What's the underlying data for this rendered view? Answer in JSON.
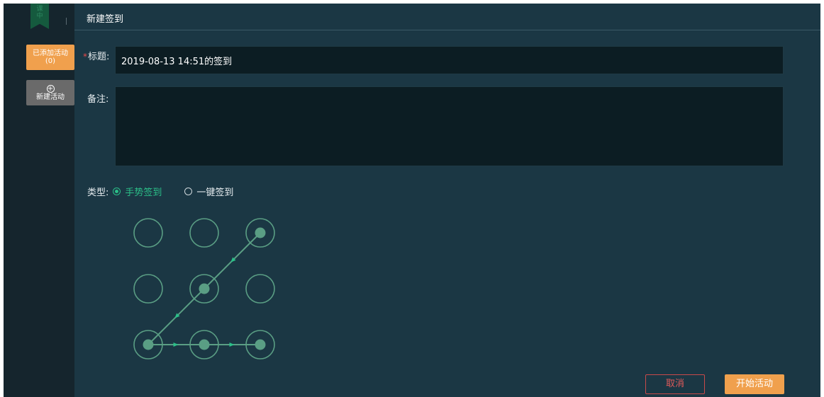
{
  "logo": {
    "chars": [
      "课",
      "中"
    ]
  },
  "sidebar": {
    "added_label": "已添加活动",
    "added_count": "(0)",
    "new_label": "新建活动"
  },
  "header": {
    "title": "新建签到"
  },
  "form": {
    "required_mark": "*",
    "title_label": "标题:",
    "title_value": "2019-08-13 14:51的签到",
    "remark_label": "备注:",
    "remark_value": "",
    "type_label": "类型:",
    "type_options": [
      "手势签到",
      "一键签到"
    ],
    "selected_type": "手势签到"
  },
  "gesture": {
    "grid": 3,
    "path": [
      2,
      4,
      6,
      7,
      8
    ]
  },
  "buttons": {
    "cancel": "取消",
    "start": "开始活动"
  },
  "colors": {
    "accent_orange": "#f0a04d",
    "accent_green": "#2bbf88",
    "gesture_green": "#5a9e84",
    "cancel_red": "#e05a5a"
  }
}
